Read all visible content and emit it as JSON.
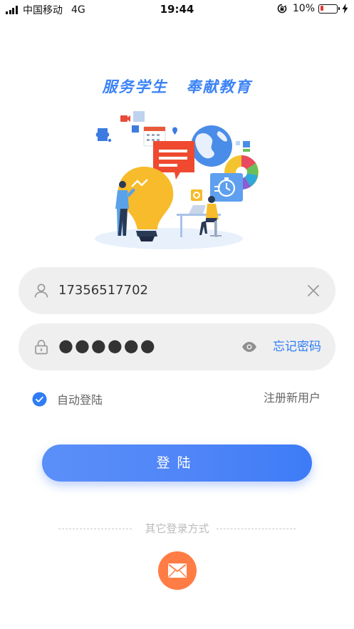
{
  "status_bar": {
    "carrier": "中国移动",
    "network": "4G",
    "time": "19:44",
    "battery": "10%"
  },
  "slogan": {
    "part1": "服务学生",
    "part2": "奉献教育"
  },
  "login_form": {
    "phone_value": "17356517702",
    "password_value": "●●●●●●",
    "forgot_label": "忘记密码",
    "auto_login_label": "自动登陆",
    "auto_login_checked": true,
    "register_label": "注册新用户",
    "submit_label": "登陆"
  },
  "other_login": {
    "label": "其它登录方式",
    "methods": [
      "mail-icon"
    ]
  },
  "colors": {
    "accent": "#3b82f6",
    "button_gradient_start": "#5b8ff8",
    "button_gradient_end": "#3d7cf7",
    "mail_button": "#ff7d45",
    "battery_low": "#e53935"
  }
}
